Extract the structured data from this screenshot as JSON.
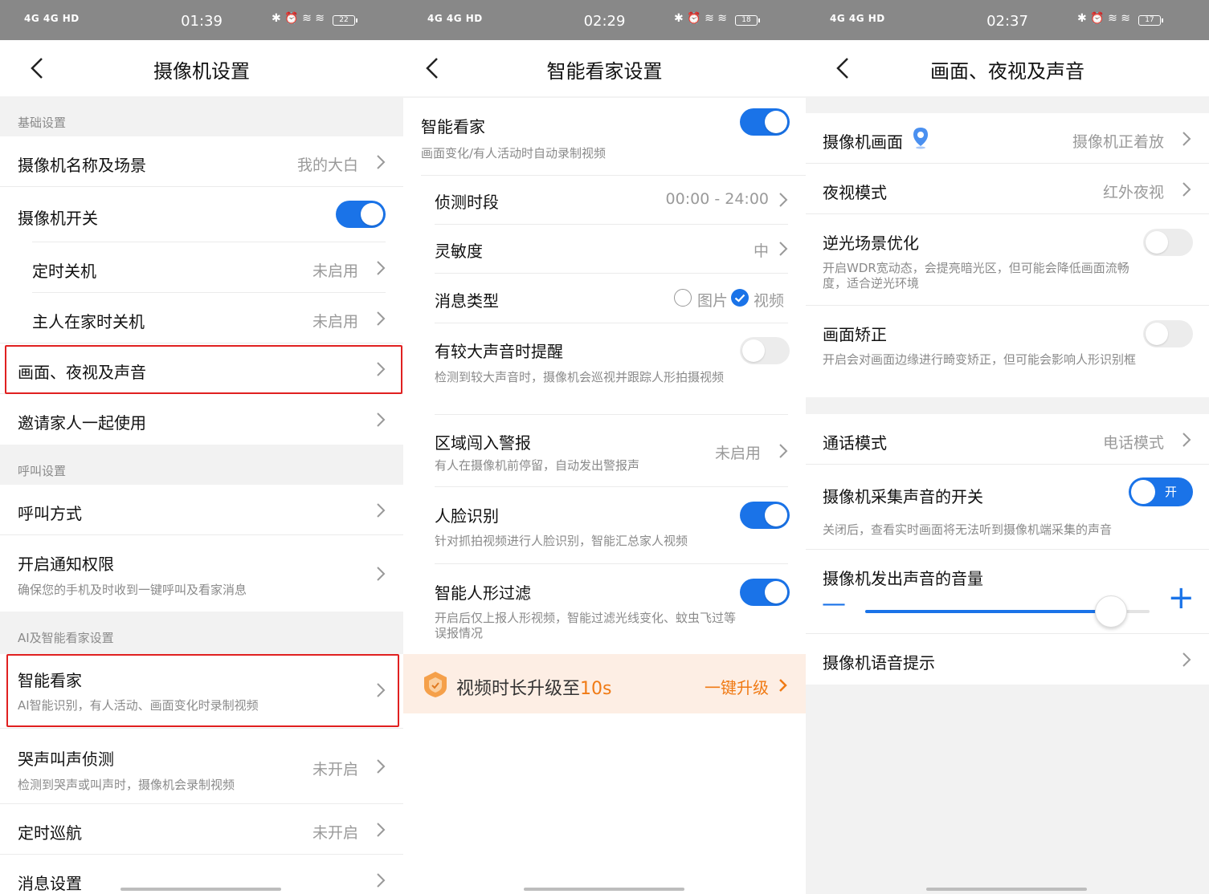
{
  "colors": {
    "accent": "#1a73e8",
    "highlight": "#e02020",
    "promo_text": "#f07a14"
  },
  "p1": {
    "status": {
      "signal": "4G 4G HD",
      "time": "01:39",
      "battery": "22"
    },
    "title": "摄像机设置",
    "sections": {
      "basic": "基础设置",
      "call": "呼叫设置",
      "ai": "AI及智能看家设置"
    },
    "rows": {
      "name_scene": {
        "label": "摄像机名称及场景",
        "value": "我的大白"
      },
      "camera_switch": {
        "label": "摄像机开关",
        "on": true
      },
      "timed_off": {
        "label": "定时关机",
        "value": "未启用"
      },
      "home_off": {
        "label": "主人在家时关机",
        "value": "未启用"
      },
      "picture": {
        "label": "画面、夜视及声音"
      },
      "invite": {
        "label": "邀请家人一起使用"
      },
      "call_mode": {
        "label": "呼叫方式"
      },
      "notify": {
        "label": "开启通知权限",
        "desc": "确保您的手机及时收到一键呼叫及看家消息"
      },
      "smart_home": {
        "label": "智能看家",
        "desc": "AI智能识别，有人活动、画面变化时录制视频"
      },
      "cry": {
        "label": "哭声叫声侦测",
        "desc": "检测到哭声或叫声时，摄像机会录制视频",
        "value": "未开启"
      },
      "patrol": {
        "label": "定时巡航",
        "value": "未开启"
      },
      "message": {
        "label": "消息设置"
      }
    }
  },
  "p2": {
    "status": {
      "signal": "4G 4G HD",
      "time": "02:29",
      "battery": "18"
    },
    "title": "智能看家设置",
    "rows": {
      "smart_home": {
        "label": "智能看家",
        "desc": "画面变化/有人活动时自动录制视频",
        "on": true
      },
      "period": {
        "label": "侦测时段",
        "value": "00:00 - 24:00"
      },
      "sensitivity": {
        "label": "灵敏度",
        "value": "中"
      },
      "msg_type": {
        "label": "消息类型",
        "opt1": "图片",
        "opt2": "视频",
        "selected": "视频"
      },
      "sound": {
        "label": "有较大声音时提醒",
        "desc": "检测到较大声音时，摄像机会巡视并跟踪人形拍摄视频",
        "on": false
      },
      "zone": {
        "label": "区域闯入警报",
        "desc": "有人在摄像机前停留，自动发出警报声",
        "value": "未启用"
      },
      "face": {
        "label": "人脸识别",
        "desc": "针对抓拍视频进行人脸识别，智能汇总家人视频",
        "on": true
      },
      "human": {
        "label": "智能人形过滤",
        "desc": "开启后仅上报人形视频，智能过滤光线变化、蚊虫飞过等误报情况",
        "on": true
      }
    },
    "promo": {
      "text_prefix": "视频时长升级至",
      "text_highlight": "10s",
      "action": "一键升级"
    }
  },
  "p3": {
    "status": {
      "signal": "4G 4G HD",
      "time": "02:37",
      "battery": "17"
    },
    "title": "画面、夜视及声音",
    "rows": {
      "picture": {
        "label": "摄像机画面",
        "value": "摄像机正着放"
      },
      "night": {
        "label": "夜视模式",
        "value": "红外夜视"
      },
      "backlight": {
        "label": "逆光场景优化",
        "desc": "开启WDR宽动态，会提亮暗光区，但可能会降低画面流畅度，适合逆光环境",
        "on": false
      },
      "correction": {
        "label": "画面矫正",
        "desc": "开启会对画面边缘进行畸变矫正，但可能会影响人形识别框",
        "on": false
      },
      "talk": {
        "label": "通话模式",
        "value": "电话模式"
      },
      "mic": {
        "label": "摄像机采集声音的开关",
        "desc": "关闭后，查看实时画面将无法听到摄像机端采集的声音",
        "toggle_text": "开",
        "on": true
      },
      "volume": {
        "label": "摄像机发出声音的音量",
        "level": 0.87,
        "minus": "—",
        "plus": "+"
      },
      "voice": {
        "label": "摄像机语音提示"
      }
    }
  }
}
